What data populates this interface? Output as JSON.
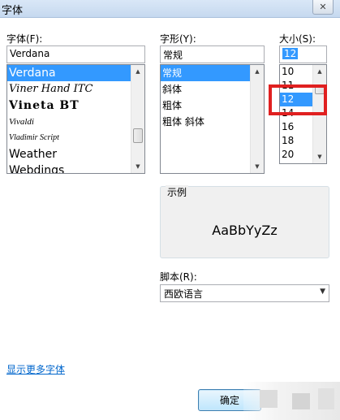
{
  "window": {
    "title": "字体",
    "close_label": "✕"
  },
  "font": {
    "label": "字体(F):",
    "value": "Verdana",
    "items": [
      "Verdana",
      "Viner Hand ITC",
      "Vineta BT",
      "Vivaldi",
      "Vladimir Script",
      "Weather",
      "Webdings"
    ],
    "selected_index": 0
  },
  "style": {
    "label": "字形(Y):",
    "value": "常规",
    "items": [
      "常规",
      "斜体",
      "粗体",
      "粗体 斜体"
    ],
    "selected_index": 0
  },
  "size": {
    "label": "大小(S):",
    "value": "12",
    "items": [
      "10",
      "11",
      "12",
      "14",
      "16",
      "18",
      "20"
    ],
    "selected_index": 2
  },
  "sample": {
    "legend": "示例",
    "text": "AaBbYyZz"
  },
  "script": {
    "label": "脚本(R):",
    "value": "西欧语言"
  },
  "more_fonts_link": "显示更多字体",
  "ok_button": "确定",
  "colors": {
    "selection": "#3399ff",
    "highlight_box": "#e02020",
    "link": "#0066cc"
  }
}
